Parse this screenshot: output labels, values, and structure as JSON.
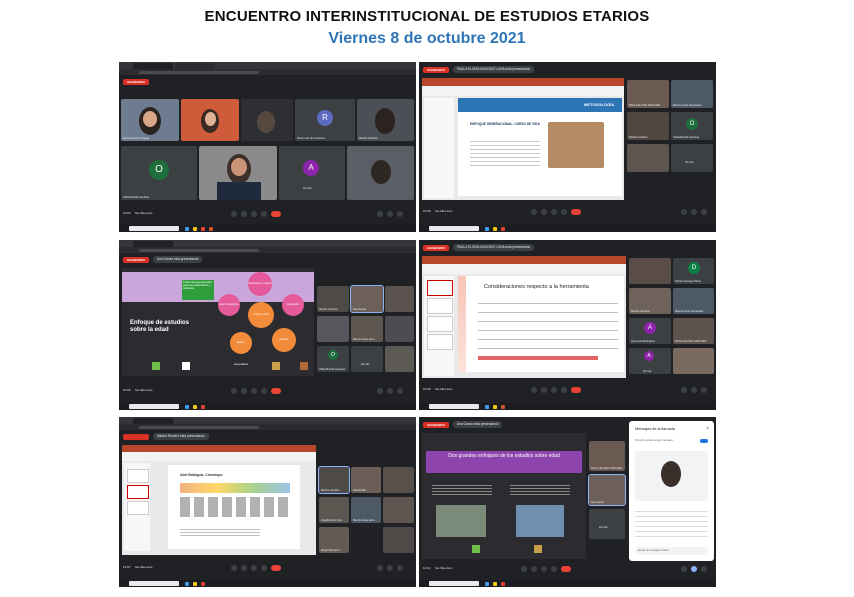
{
  "header": {
    "title": "ENCUENTRO INTERINSTITUCIONAL DE ESTUDIOS ETARIOS",
    "subtitle": "Viernes 8 de octubre 2021"
  },
  "colors": {
    "title": "#111111",
    "subtitle": "#2e75b6",
    "meet_bg": "#202124",
    "tile_bg": "#3c4043",
    "end_call": "#ea4335",
    "recording": "#d93025",
    "slide_purple": "#8e44ad",
    "powerpoint_ribbon": "#b7472a"
  },
  "screenshots": [
    {
      "name": "meet-grid-view",
      "recording_label": "GRABANDO",
      "clock": "10:04",
      "meeting_code": "fon-hiku-zam",
      "participants": [
        {
          "label": "Mercedes Ruiz Ortega"
        },
        {
          "label": ""
        },
        {
          "label": ""
        },
        {
          "label": "Rosio mita de la barrera",
          "initial": "R"
        },
        {
          "label": "Martha Carolina"
        },
        {
          "label": "Ofelia Bonilla Gamboa",
          "initial": "O"
        },
        {
          "label": ""
        },
        {
          "label": "22 más",
          "initial": "A"
        },
        {
          "label": ""
        }
      ],
      "taskbar_search": "Escribe aquí para buscar"
    },
    {
      "name": "meet-presenting-metodologia",
      "recording_label": "GRABANDO",
      "presenter_banner": "PAULA ELOISA SANCHEZ LUNA está presentando",
      "slide_header": "METODOLOGÍA",
      "slide_title": "ENFOQUE GENERACIONAL: CURSO DE VIDA",
      "side_tiles": [
        {
          "label": "PAULA ELOISA SANCHEZ"
        },
        {
          "label": "Marcos Arias Hernandez"
        },
        {
          "label": "Martha Carolina"
        },
        {
          "label": "Ofelia Bonilla Gamboa",
          "initial": "O"
        },
        {
          "label": "20 más"
        }
      ],
      "clock": "10:36",
      "meeting_code": "fon-hiku-zam"
    },
    {
      "name": "meet-presenting-enfoques",
      "recording_label": "GRABANDO",
      "presenter_banner": "Ana Garcia está presentando",
      "slide_title": "Enfoque de estudios sobre la edad",
      "slide_box": "Incidencias generacionales (aspectos sociopolíticos y culturales)",
      "circles": [
        "Nacimiento y muerte",
        "Edad cronológica",
        "Curso de vida",
        "Generación",
        "Roles y expectativas",
        "Cohorte"
      ],
      "side_tiles": [
        {
          "label": "Martha Carolina"
        },
        {
          "label": "Ana Garcia"
        },
        {
          "label": "Marcos Arias Hern..."
        },
        {
          "label": "Ofelia Bonilla Gamboa",
          "initial": "O"
        },
        {
          "label": "18 más"
        }
      ],
      "clock": "10:56",
      "meeting_code": "fon-hiku-zam"
    },
    {
      "name": "meet-presenting-consideraciones",
      "recording_label": "GRABANDO",
      "presenter_banner": "PAULA ELOISA SANCHEZ LUNA está presentando",
      "slide_title": "Consideraciones respecto a la herramienta",
      "side_tiles": [
        {
          "label": "",
          "initial": ""
        },
        {
          "label": "Dafne Camargo Pérez",
          "initial": "D"
        },
        {
          "label": "Martha Carolina"
        },
        {
          "label": "Marcos Arias Hernandez"
        },
        {
          "label": "Ana Lucia Rodriguez",
          "initial": "A"
        },
        {
          "label": "PAULA ELOISA SANCHEZ"
        },
        {
          "label": "20 más",
          "initial": "A"
        },
        {
          "label": ""
        }
      ],
      "clock": "10:45",
      "meeting_code": "fon-hiku-zam"
    },
    {
      "name": "meet-presenting-cronotopo",
      "presenter_banner": "Martha Romero está presentando",
      "slide_title": "Abel Balbiguiz, Cronotopo",
      "side_tiles": [
        {
          "label": "Martha Carolina"
        },
        {
          "label": "Danela Bill..."
        },
        {
          "label": "Angélica Ruiz Her..."
        },
        {
          "label": "Marcos Arias Hern..."
        },
        {
          "label": "Edgar Maroquin..."
        },
        {
          "label": ""
        }
      ],
      "clock": "12:07",
      "meeting_code": "fon-hiku-zam"
    },
    {
      "name": "meet-presenting-dos-enfoques-chat",
      "recording_label": "GRABANDO",
      "presenter_banner": "Ana Garcia está presentando",
      "slide_title": "Dos grandes enfoques de los estudios sobre edad",
      "chat_title": "Mensajes de la llamada",
      "chat_toggle": "Permitir a todos enviar mensajes",
      "chat_input": "Enviar un mensaje a todos",
      "side_tiles": [
        {
          "label": "PAULA ELOISA SANCHEZ"
        },
        {
          "label": "Ana Garcia"
        },
        {
          "label": "22 más"
        }
      ],
      "clock": "11:10",
      "meeting_code": "fon-hiku-zam"
    }
  ]
}
